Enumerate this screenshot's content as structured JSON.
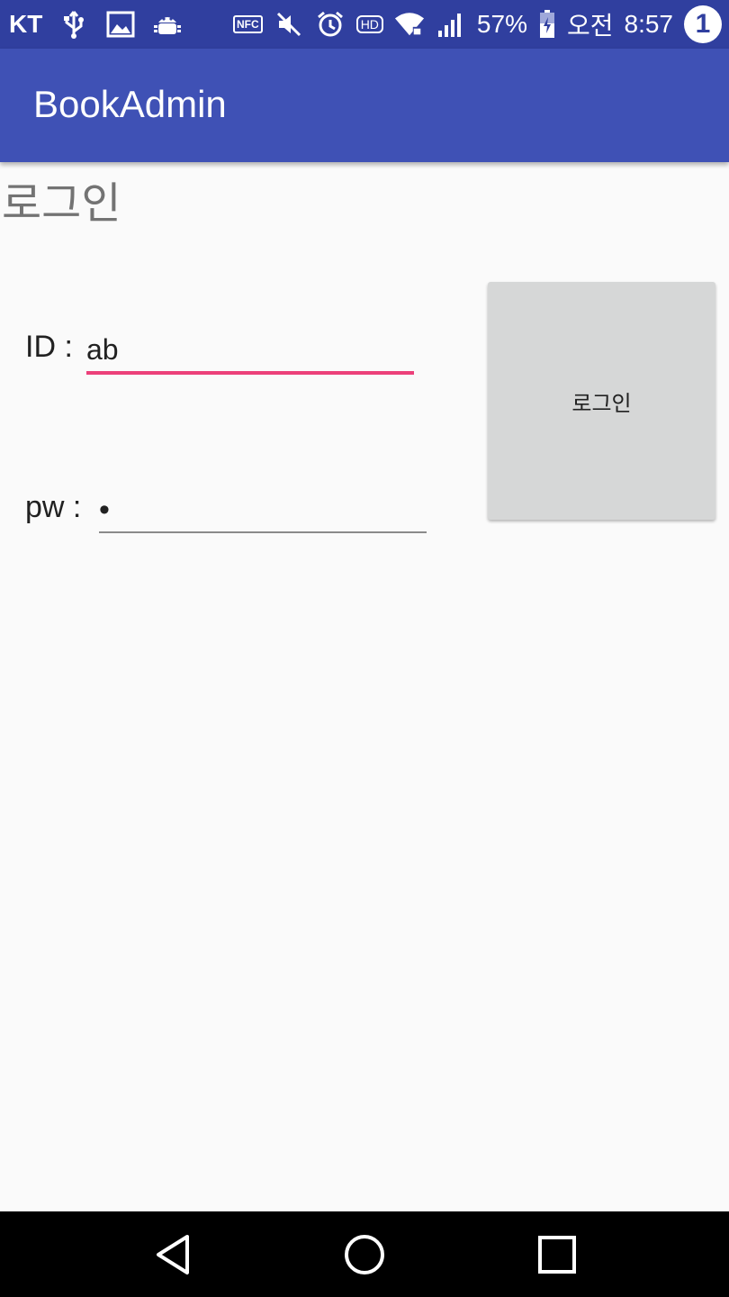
{
  "status_bar": {
    "carrier": "KT",
    "nfc_label": "NFC",
    "hd_label": "HD",
    "battery": "57%",
    "ampm": "오전",
    "time": "8:57",
    "notification_count": "1",
    "icons": [
      "usb-icon",
      "image-icon",
      "android-debug-icon",
      "nfc-icon",
      "mute-icon",
      "alarm-icon",
      "hd-voice-icon",
      "wifi-icon",
      "signal-icon",
      "battery-charging-icon"
    ]
  },
  "app_bar": {
    "title": "BookAdmin"
  },
  "page": {
    "heading": "로그인"
  },
  "form": {
    "id_label": "ID :",
    "id_value": "ab",
    "pw_label": "pw :",
    "pw_value": "•",
    "login_button": "로그인"
  },
  "colors": {
    "status_bar": "#303f9f",
    "app_bar": "#3f51b5",
    "accent": "#ec407a",
    "button_bg": "#d6d7d7",
    "background": "#fafafa"
  },
  "nav_bar": {
    "icons": [
      "back-icon",
      "home-icon",
      "recent-apps-icon"
    ]
  }
}
